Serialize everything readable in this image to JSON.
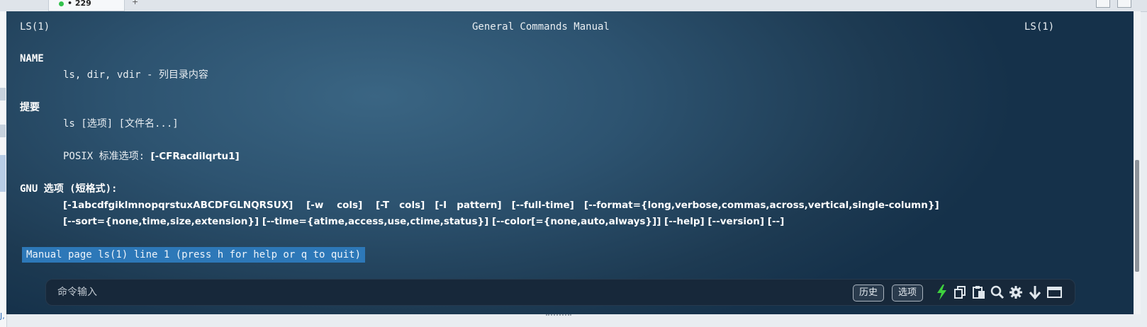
{
  "tabbar": {
    "tab_label": "• 229",
    "plus": "+"
  },
  "man": {
    "header_left": "LS(1)",
    "header_center": "General Commands Manual",
    "header_right": "LS(1)",
    "name_heading": "NAME",
    "name_text": "ls, dir, vdir - 列目录内容",
    "synopsis_heading": "提要",
    "synopsis_line": "ls [选项] [文件名...]",
    "posix_prefix": "POSIX 标准选项: ",
    "posix_opts": "[-CFRacdilqrtu1]",
    "gnu_heading": "GNU 选项 (短格式):",
    "gnu_line1": "[-1abcdfgiklmnopqrstuxABCDFGLNQRSUX]    [-w    cols]    [-T   cols]   [-I   pattern]   [--full-time]   [--format={long,verbose,commas,across,vertical,single-column}]",
    "gnu_line2": "[--sort={none,time,size,extension}] [--time={atime,access,use,ctime,status}] [--color[={none,auto,always}]] [--help] [--version] [--]",
    "status": "Manual page ls(1) line 1 (press h for help or q to quit)"
  },
  "cmdbar": {
    "placeholder": "命令输入",
    "history_label": "历史",
    "options_label": "选项",
    "icons": [
      "lightning-icon",
      "copy-icon",
      "paste-icon",
      "search-icon",
      "gear-icon",
      "arrow-down-icon",
      "window-icon"
    ],
    "accent": "#3ed13e"
  },
  "colors": {
    "terminal_bg": "#2d5370",
    "status_bg": "#2d78b8",
    "cmdbar_bg": "#17283a"
  }
}
